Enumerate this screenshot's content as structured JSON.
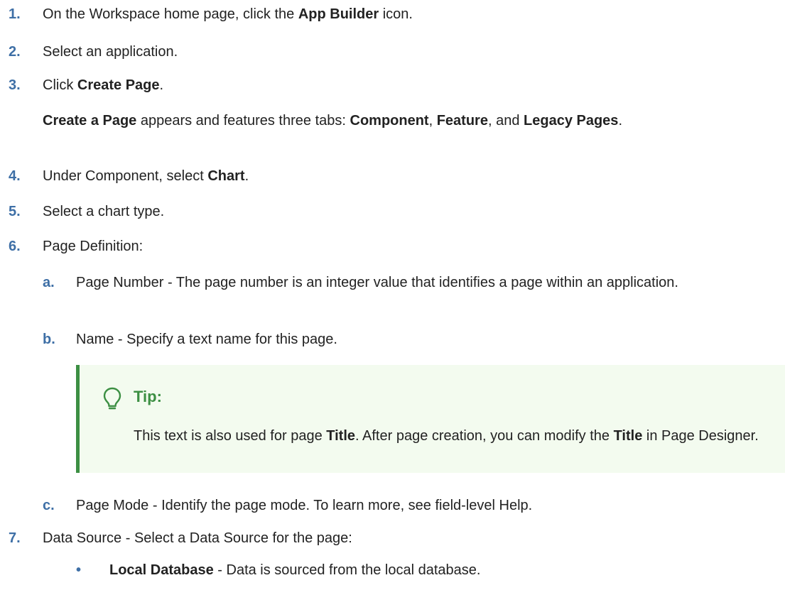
{
  "steps": [
    {
      "num": "1.",
      "pre": "On the Workspace home page, click the ",
      "bold": "App Builder",
      "post": " icon."
    },
    {
      "num": "2.",
      "text": "Select an application."
    },
    {
      "num": "3.",
      "pre": "Click ",
      "bold": "Create Page",
      "post": "."
    },
    {
      "num": "4.",
      "pre": "Under Component, select ",
      "bold": "Chart",
      "post": "."
    },
    {
      "num": "5.",
      "text": "Select a chart type."
    },
    {
      "num": "6.",
      "text": "Page Definition:"
    },
    {
      "num": "7.",
      "text": "Data Source - Select a Data Source for the page:"
    }
  ],
  "create_page_note": {
    "b1": "Create a Page",
    "t1": " appears and features three tabs: ",
    "b2": "Component",
    "t2": ", ",
    "b3": "Feature",
    "t3": ", and ",
    "b4": "Legacy Pages",
    "t4": "."
  },
  "substeps": [
    {
      "letter": "a.",
      "text": "Page Number - The page number is an integer value that identifies a page within an application."
    },
    {
      "letter": "b.",
      "text": "Name - Specify a text name for this page."
    },
    {
      "letter": "c.",
      "text": "Page Mode - Identify the page mode. To learn more, see field-level Help."
    }
  ],
  "tip": {
    "title": "Tip:",
    "t1": "This text is also used for page ",
    "b1": "Title",
    "t2": ". After page creation, you can modify the ",
    "b2": "Title",
    "t3": " in Page Designer.",
    "icon": "lightbulb-icon",
    "accent": "#3c8f43",
    "background": "#f3fbef"
  },
  "bullets": [
    {
      "marker": "•",
      "bold": "Local Database",
      "text": " - Data is sourced from the local database."
    }
  ],
  "colors": {
    "step_number": "#3e6fa6",
    "text": "#222222"
  }
}
